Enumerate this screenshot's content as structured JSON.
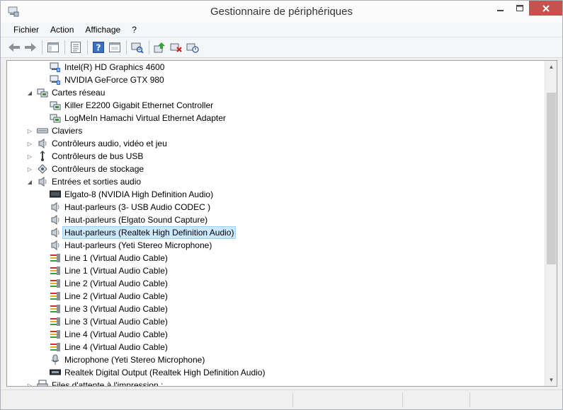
{
  "window": {
    "title": "Gestionnaire de périphériques"
  },
  "menu": [
    "Fichier",
    "Action",
    "Affichage",
    "?"
  ],
  "toolbar": {
    "buttons": [
      "back-icon",
      "forward-icon",
      "show-hide-tree-icon",
      "properties-icon",
      "help-icon",
      "view-icon",
      "scan-hardware-icon",
      "update-driver-icon",
      "uninstall-icon",
      "enable-disable-icon"
    ]
  },
  "tree": {
    "rows": [
      {
        "label": "Intel(R) HD Graphics 4600",
        "level": 2,
        "icon": "display-adapter-icon"
      },
      {
        "label": "NVIDIA GeForce GTX 980",
        "level": 2,
        "icon": "display-adapter-icon"
      },
      {
        "label": "Cartes réseau",
        "level": 1,
        "icon": "network-adapter-icon",
        "expander": "expanded"
      },
      {
        "label": "Killer E2200 Gigabit Ethernet Controller",
        "level": 2,
        "icon": "network-adapter-icon"
      },
      {
        "label": "LogMeIn Hamachi Virtual Ethernet Adapter",
        "level": 2,
        "icon": "network-adapter-icon"
      },
      {
        "label": "Claviers",
        "level": 1,
        "icon": "keyboard-icon",
        "expander": "collapsed"
      },
      {
        "label": "Contrôleurs audio, vidéo et jeu",
        "level": 1,
        "icon": "speaker-icon",
        "expander": "collapsed"
      },
      {
        "label": "Contrôleurs de bus USB",
        "level": 1,
        "icon": "usb-icon",
        "expander": "collapsed"
      },
      {
        "label": "Contrôleurs de stockage",
        "level": 1,
        "icon": "storage-controller-icon",
        "expander": "collapsed"
      },
      {
        "label": "Entrées et sorties audio",
        "level": 1,
        "icon": "speaker-icon",
        "expander": "expanded"
      },
      {
        "label": "Elgato-8 (NVIDIA High Definition Audio)",
        "level": 2,
        "icon": "monitor-audio-icon"
      },
      {
        "label": "Haut-parleurs (3- USB Audio CODEC )",
        "level": 2,
        "icon": "speaker-icon"
      },
      {
        "label": "Haut-parleurs (Elgato Sound Capture)",
        "level": 2,
        "icon": "speaker-icon"
      },
      {
        "label": "Haut-parleurs (Realtek High Definition Audio)",
        "level": 2,
        "icon": "speaker-icon",
        "selected": true
      },
      {
        "label": "Haut-parleurs (Yeti Stereo Microphone)",
        "level": 2,
        "icon": "speaker-icon"
      },
      {
        "label": "Line 1 (Virtual Audio Cable)",
        "level": 2,
        "icon": "audio-cable-icon"
      },
      {
        "label": "Line 1 (Virtual Audio Cable)",
        "level": 2,
        "icon": "audio-cable-icon"
      },
      {
        "label": "Line 2 (Virtual Audio Cable)",
        "level": 2,
        "icon": "audio-cable-icon"
      },
      {
        "label": "Line 2 (Virtual Audio Cable)",
        "level": 2,
        "icon": "audio-cable-icon"
      },
      {
        "label": "Line 3 (Virtual Audio Cable)",
        "level": 2,
        "icon": "audio-cable-icon"
      },
      {
        "label": "Line 3 (Virtual Audio Cable)",
        "level": 2,
        "icon": "audio-cable-icon"
      },
      {
        "label": "Line 4 (Virtual Audio Cable)",
        "level": 2,
        "icon": "audio-cable-icon"
      },
      {
        "label": "Line 4 (Virtual Audio Cable)",
        "level": 2,
        "icon": "audio-cable-icon"
      },
      {
        "label": "Microphone (Yeti Stereo Microphone)",
        "level": 2,
        "icon": "microphone-icon"
      },
      {
        "label": "Realtek Digital Output (Realtek High Definition Audio)",
        "level": 2,
        "icon": "digital-output-icon"
      },
      {
        "label": "Files d'attente à l'impression :",
        "level": 1,
        "icon": "printer-icon",
        "expander": "collapsed"
      }
    ]
  },
  "colors": {
    "selection_bg": "#cce8ff",
    "selection_border": "#99d1ff",
    "close_button": "#c7514e"
  }
}
